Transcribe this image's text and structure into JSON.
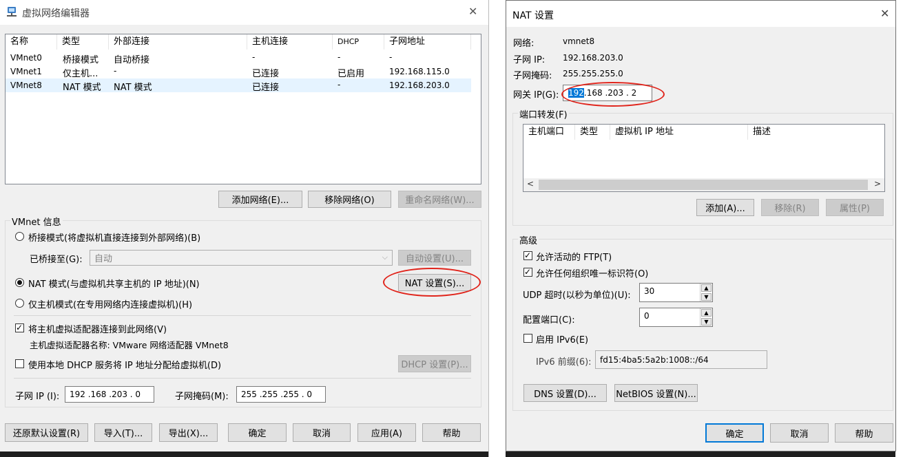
{
  "left_window": {
    "title": "虚拟网络编辑器",
    "columns": [
      "名称",
      "类型",
      "外部连接",
      "主机连接",
      "DHCP",
      "子网地址"
    ],
    "rows": [
      [
        "VMnet0",
        "桥接模式",
        "自动桥接",
        "-",
        "-",
        "-"
      ],
      [
        "VMnet1",
        "仅主机...",
        "-",
        "已连接",
        "已启用",
        "192.168.115.0"
      ],
      [
        "VMnet8",
        "NAT 模式",
        "NAT 模式",
        "已连接",
        "-",
        "192.168.203.0"
      ]
    ],
    "add_network": "添加网络(E)...",
    "remove_network": "移除网络(O)",
    "rename_network": "重命名网络(W)...",
    "vmnet_info": "VMnet 信息",
    "bridged_mode": "桥接模式(将虚拟机直接连接到外部网络)(B)",
    "bridged_to_label": "已桥接至(G):",
    "bridged_to_value": "自动",
    "auto_settings": "自动设置(U)...",
    "nat_mode": "NAT 模式(与虚拟机共享主机的 IP 地址)(N)",
    "nat_settings": "NAT 设置(S)...",
    "host_only_mode": "仅主机模式(在专用网络内连接虚拟机)(H)",
    "connect_adapter": "将主机虚拟适配器连接到此网络(V)",
    "adapter_name": "主机虚拟适配器名称: VMware 网络适配器 VMnet8",
    "use_dhcp": "使用本地 DHCP 服务将 IP 地址分配给虚拟机(D)",
    "dhcp_settings": "DHCP 设置(P)...",
    "subnet_ip_label": "子网 IP (I):",
    "subnet_ip_value": "192 .168 .203 .  0",
    "subnet_mask_label": "子网掩码(M):",
    "subnet_mask_value": "255 .255 .255 .  0",
    "restore_defaults": "还原默认设置(R)",
    "import": "导入(T)...",
    "export": "导出(X)...",
    "ok": "确定",
    "cancel": "取消",
    "apply": "应用(A)",
    "help": "帮助",
    "close_glyph": "✕"
  },
  "right_window": {
    "title": "NAT 设置",
    "network_label": "网络:",
    "network_value": "vmnet8",
    "subnet_ip_label": "子网 IP:",
    "subnet_ip_value": "192.168.203.0",
    "subnet_mask_label": "子网掩码:",
    "subnet_mask_value": "255.255.255.0",
    "gateway_label": "网关 IP(G):",
    "gateway_selected": "192",
    "gateway_rest": ".168 .203 .  2",
    "port_forwarding": "端口转发(F)",
    "pf_columns": [
      "主机端口",
      "类型",
      "虚拟机 IP 地址",
      "描述"
    ],
    "add": "添加(A)...",
    "remove": "移除(R)",
    "properties": "属性(P)",
    "advanced": "高级",
    "allow_ftp": "允许活动的 FTP(T)",
    "allow_oui": "允许任何组织唯一标识符(O)",
    "udp_timeout_label": "UDP 超时(以秒为单位)(U):",
    "udp_timeout_value": "30",
    "config_port_label": "配置端口(C):",
    "config_port_value": "0",
    "enable_ipv6": "启用 IPv6(E)",
    "ipv6_prefix_label": "IPv6 前缀(6):",
    "ipv6_prefix_value": "fd15:4ba5:5a2b:1008::/64",
    "dns_settings": "DNS 设置(D)...",
    "netbios_settings": "NetBIOS 设置(N)...",
    "ok": "确定",
    "cancel": "取消",
    "help": "帮助",
    "close_glyph": "✕"
  },
  "colors": {
    "accent": "#0078d7",
    "annotation": "#e0241b",
    "selected_row": "#e5f3ff"
  }
}
